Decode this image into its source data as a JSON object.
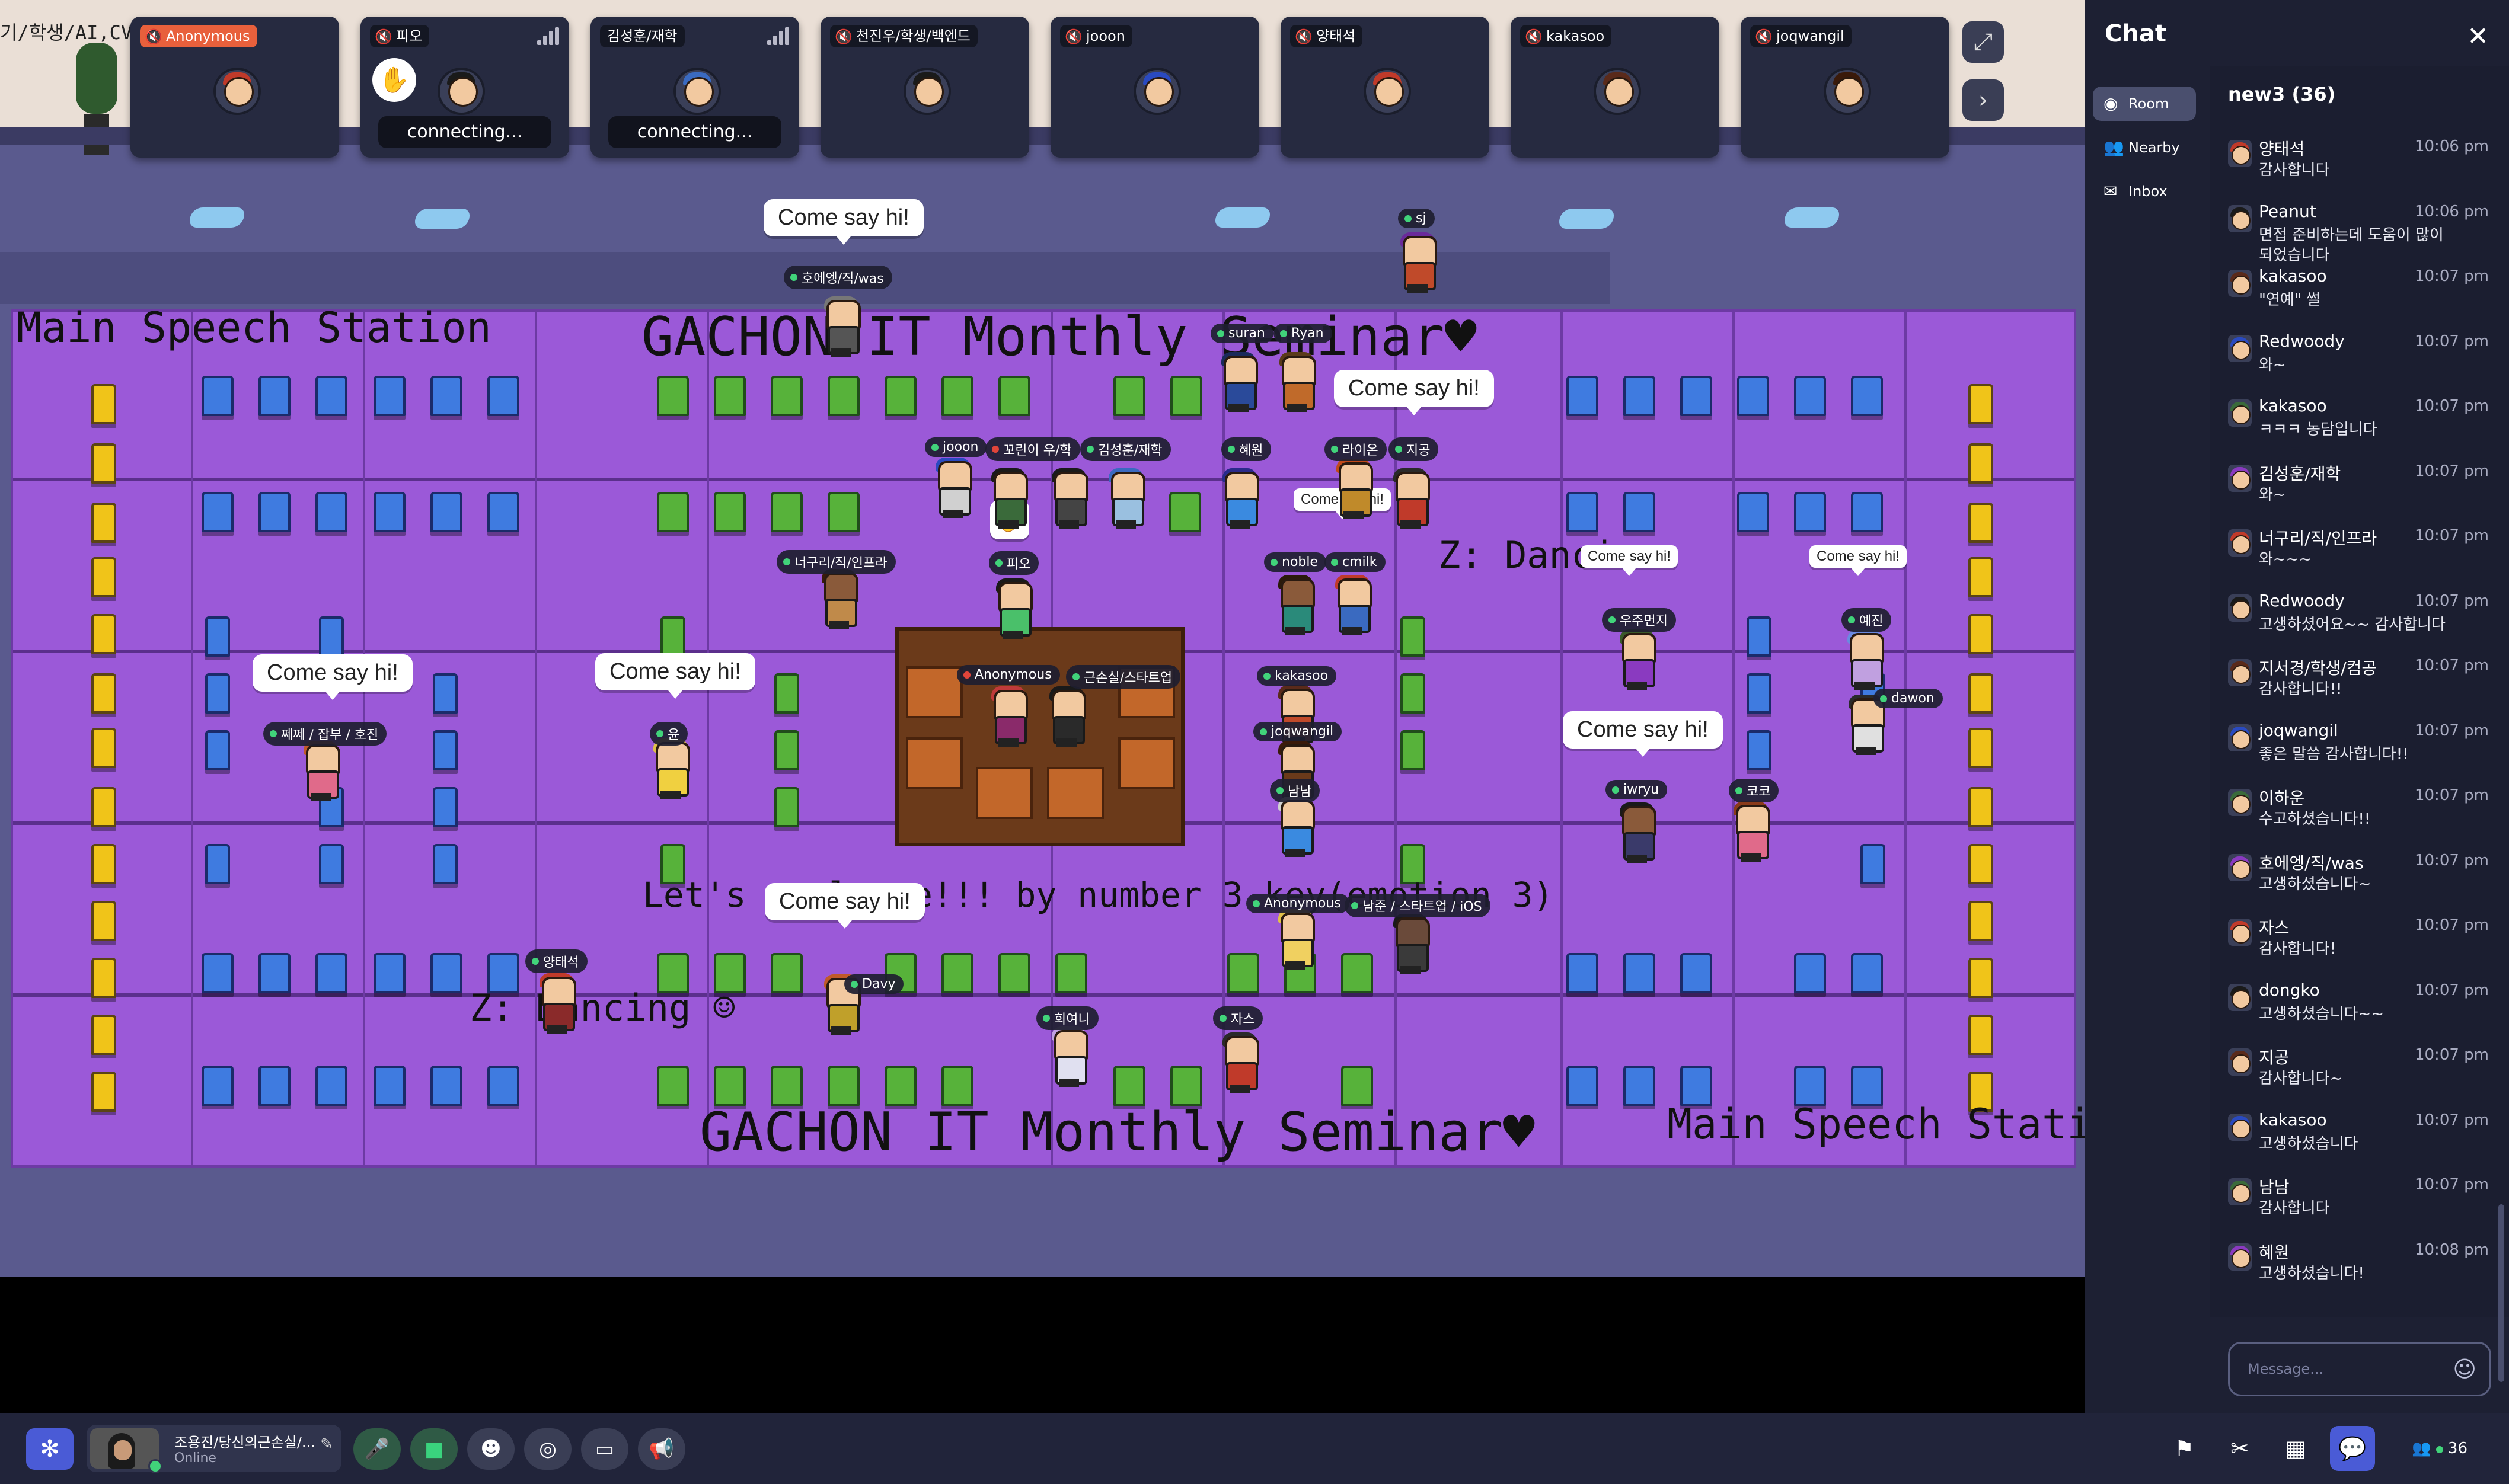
{
  "map": {
    "labels": {
      "main_speech_tl": "Main Speech Station",
      "main_speech_br": "Main Speech Station",
      "seminar_top": "GACHON IT Monthly Seminar♥",
      "seminar_bottom": "GACHON IT Monthly Seminar♥",
      "dance_1": "Z: Dancing ☺",
      "dance_2": "Z: Dancin",
      "applause": "Let's applause!!! by number 3 key(emotion 3)",
      "wall_left": "기/학생/AI,CV"
    },
    "bubbles": [
      "Come say hi!",
      "Come say hi!",
      "Come say hi!",
      "Come say hi!",
      "Come say hi!",
      "Come say hi!",
      "Come say hi!",
      "Come say hi!",
      "Come say hi!"
    ],
    "tags": [
      "호에엥/직/was",
      "sj",
      "suran",
      "Ryan",
      "jooon",
      "꼬린이 우/학",
      "김성훈/재학",
      "혜원",
      "라이온",
      "지공",
      "너구리/직/인프라",
      "피오",
      "noble",
      "cmilk",
      "우주먼지",
      "예진",
      "Anonymous",
      "근손실/스타트업",
      "kakasoo",
      "dawon",
      "쩨쩨 / 잡부 / 호진",
      "윤",
      "joqwangil",
      "남남",
      "iwryu",
      "코코",
      "Anonymous",
      "남준 / 스타트업 / iOS",
      "양태석",
      "Davy",
      "희여니",
      "자스"
    ]
  },
  "tiles": [
    {
      "name": "Anonymous",
      "connecting": ""
    },
    {
      "name": "피오",
      "connecting": "connecting..."
    },
    {
      "name": "김성훈/재학",
      "connecting": "connecting..."
    },
    {
      "name": "천진우/학생/백엔드",
      "connecting": ""
    },
    {
      "name": "jooon",
      "connecting": ""
    },
    {
      "name": "양태석",
      "connecting": ""
    },
    {
      "name": "kakasoo",
      "connecting": ""
    },
    {
      "name": "joqwangil",
      "connecting": ""
    }
  ],
  "chat": {
    "title": "Chat",
    "tabs": {
      "room": "Room",
      "nearby": "Nearby",
      "inbox": "Inbox"
    },
    "room_name": "new3 (36)",
    "placeholder": "Message...",
    "messages": [
      {
        "name": "양태석",
        "time": "10:06 pm",
        "text": "감사합니다"
      },
      {
        "name": "Peanut",
        "time": "10:06 pm",
        "text": "면접 준비하는데 도움이 많이 되었습니다"
      },
      {
        "name": "kakasoo",
        "time": "10:07 pm",
        "text": "\"연예\" 썰"
      },
      {
        "name": "Redwoody",
        "time": "10:07 pm",
        "text": "와~"
      },
      {
        "name": "kakasoo",
        "time": "10:07 pm",
        "text": "ㅋㅋㅋ 농담입니다"
      },
      {
        "name": "김성훈/재학",
        "time": "10:07 pm",
        "text": "와~"
      },
      {
        "name": "너구리/직/인프라",
        "time": "10:07 pm",
        "text": "와~~~"
      },
      {
        "name": "Redwoody",
        "time": "10:07 pm",
        "text": "고생하셨어요~~ 감사합니다"
      },
      {
        "name": "지서경/학생/컴공",
        "time": "10:07 pm",
        "text": "감사합니다!!"
      },
      {
        "name": "joqwangil",
        "time": "10:07 pm",
        "text": "좋은 말씀 감사합니다!!"
      },
      {
        "name": "이하운",
        "time": "10:07 pm",
        "text": "수고하셨습니다!!"
      },
      {
        "name": "호에엥/직/was",
        "time": "10:07 pm",
        "text": "고생하셨습니다~"
      },
      {
        "name": "자스",
        "time": "10:07 pm",
        "text": "감사합니다!"
      },
      {
        "name": "dongko",
        "time": "10:07 pm",
        "text": "고생하셨습니다~~"
      },
      {
        "name": "지공",
        "time": "10:07 pm",
        "text": "감사합니다~"
      },
      {
        "name": "kakasoo",
        "time": "10:07 pm",
        "text": "고생하셨습니다"
      },
      {
        "name": "남남",
        "time": "10:07 pm",
        "text": "감사합니다"
      },
      {
        "name": "혜원",
        "time": "10:08 pm",
        "text": "고생하셨습니다!"
      }
    ]
  },
  "bar": {
    "user_name": "조용진/당신의근손실/...",
    "status": "Online",
    "participants": "36"
  },
  "colors": {
    "accent": "#4a5bd6",
    "stage": "#9b59d8",
    "panel": "#1d2033",
    "online": "#41d37a"
  }
}
